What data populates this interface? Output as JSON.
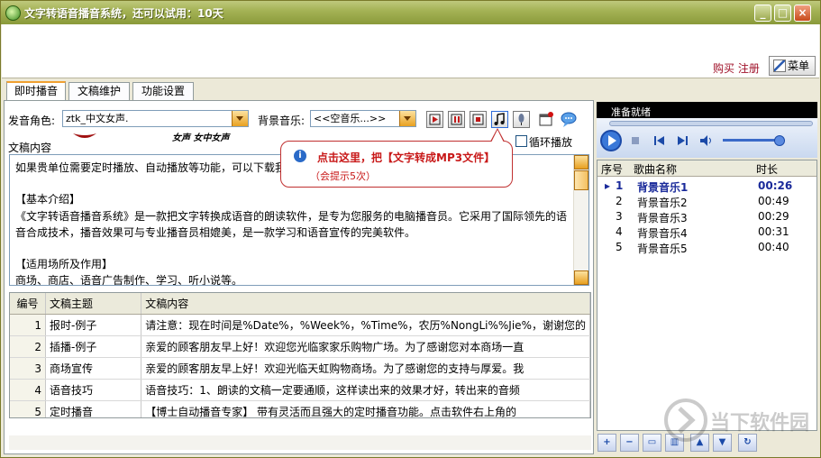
{
  "window": {
    "title": "文字转语音播音系统，还可以试用：10天",
    "buy_register": "购买 注册",
    "menu_label": "菜单"
  },
  "tabs": [
    "即时播音",
    "文稿维护",
    "功能设置"
  ],
  "voice": {
    "label": "发音角色:",
    "value": "ztk_中文女声.",
    "signature": "女声 女中女声"
  },
  "bgm": {
    "label": "背景音乐:",
    "value": "<<空音乐...>>"
  },
  "tooltip": {
    "line1": "点击这里，把【文字转成MP3文件】",
    "line2": "（会提示5次）"
  },
  "loop_label": "循环播放",
  "content_label": "文稿内容",
  "content_lines": [
    "如果贵单位需要定时播放、自动播放等功能，可以下载我",
    "",
    "【基本介绍】",
    "《文字转语音播音系统》是一款把文字转换成语音的朗读软件，是专为您服务的电脑播音员。它采用了国际领先的语",
    "音合成技术，播音效果可与专业播音员相媲美，是一款学习和语音宣传的完美软件。",
    "",
    "【适用场所及作用】",
    "商场、商店、语音广告制作、学习、听小说等。"
  ],
  "grid": {
    "headers": [
      "编号",
      "文稿主题",
      "文稿内容"
    ],
    "rows": [
      {
        "no": "1",
        "topic": "报时-例子",
        "content": "请注意：现在时间是%Date%，%Week%，%Time%，农历%NongLi%%Jie%，谢谢您的"
      },
      {
        "no": "2",
        "topic": "插播-例子",
        "content": "亲爱的顾客朋友早上好！欢迎您光临家家乐购物广场。为了感谢您对本商场一直"
      },
      {
        "no": "3",
        "topic": "商场宣传",
        "content": "亲爱的顾客朋友早上好！欢迎光临天虹购物商场。为了感谢您的支持与厚爱。我"
      },
      {
        "no": "4",
        "topic": "语音技巧",
        "content": "语音技巧：1、朗读的文稿一定要通顺，这样读出来的效果才好，转出来的音频"
      },
      {
        "no": "5",
        "topic": "定时播音",
        "content": "【博士自动播音专家】  带有灵活而且强大的定时播音功能。点击软件右上角的"
      }
    ]
  },
  "player": {
    "status": "准备就绪"
  },
  "playlist": {
    "headers": [
      "序号",
      "歌曲名称",
      "时长"
    ],
    "rows": [
      {
        "no": "1",
        "name": "背景音乐1",
        "duration": "00:26"
      },
      {
        "no": "2",
        "name": "背景音乐2",
        "duration": "00:49"
      },
      {
        "no": "3",
        "name": "背景音乐3",
        "duration": "00:29"
      },
      {
        "no": "4",
        "name": "背景音乐4",
        "duration": "00:31"
      },
      {
        "no": "5",
        "name": "背景音乐5",
        "duration": "00:40"
      }
    ]
  },
  "watermark": "当下软件园"
}
